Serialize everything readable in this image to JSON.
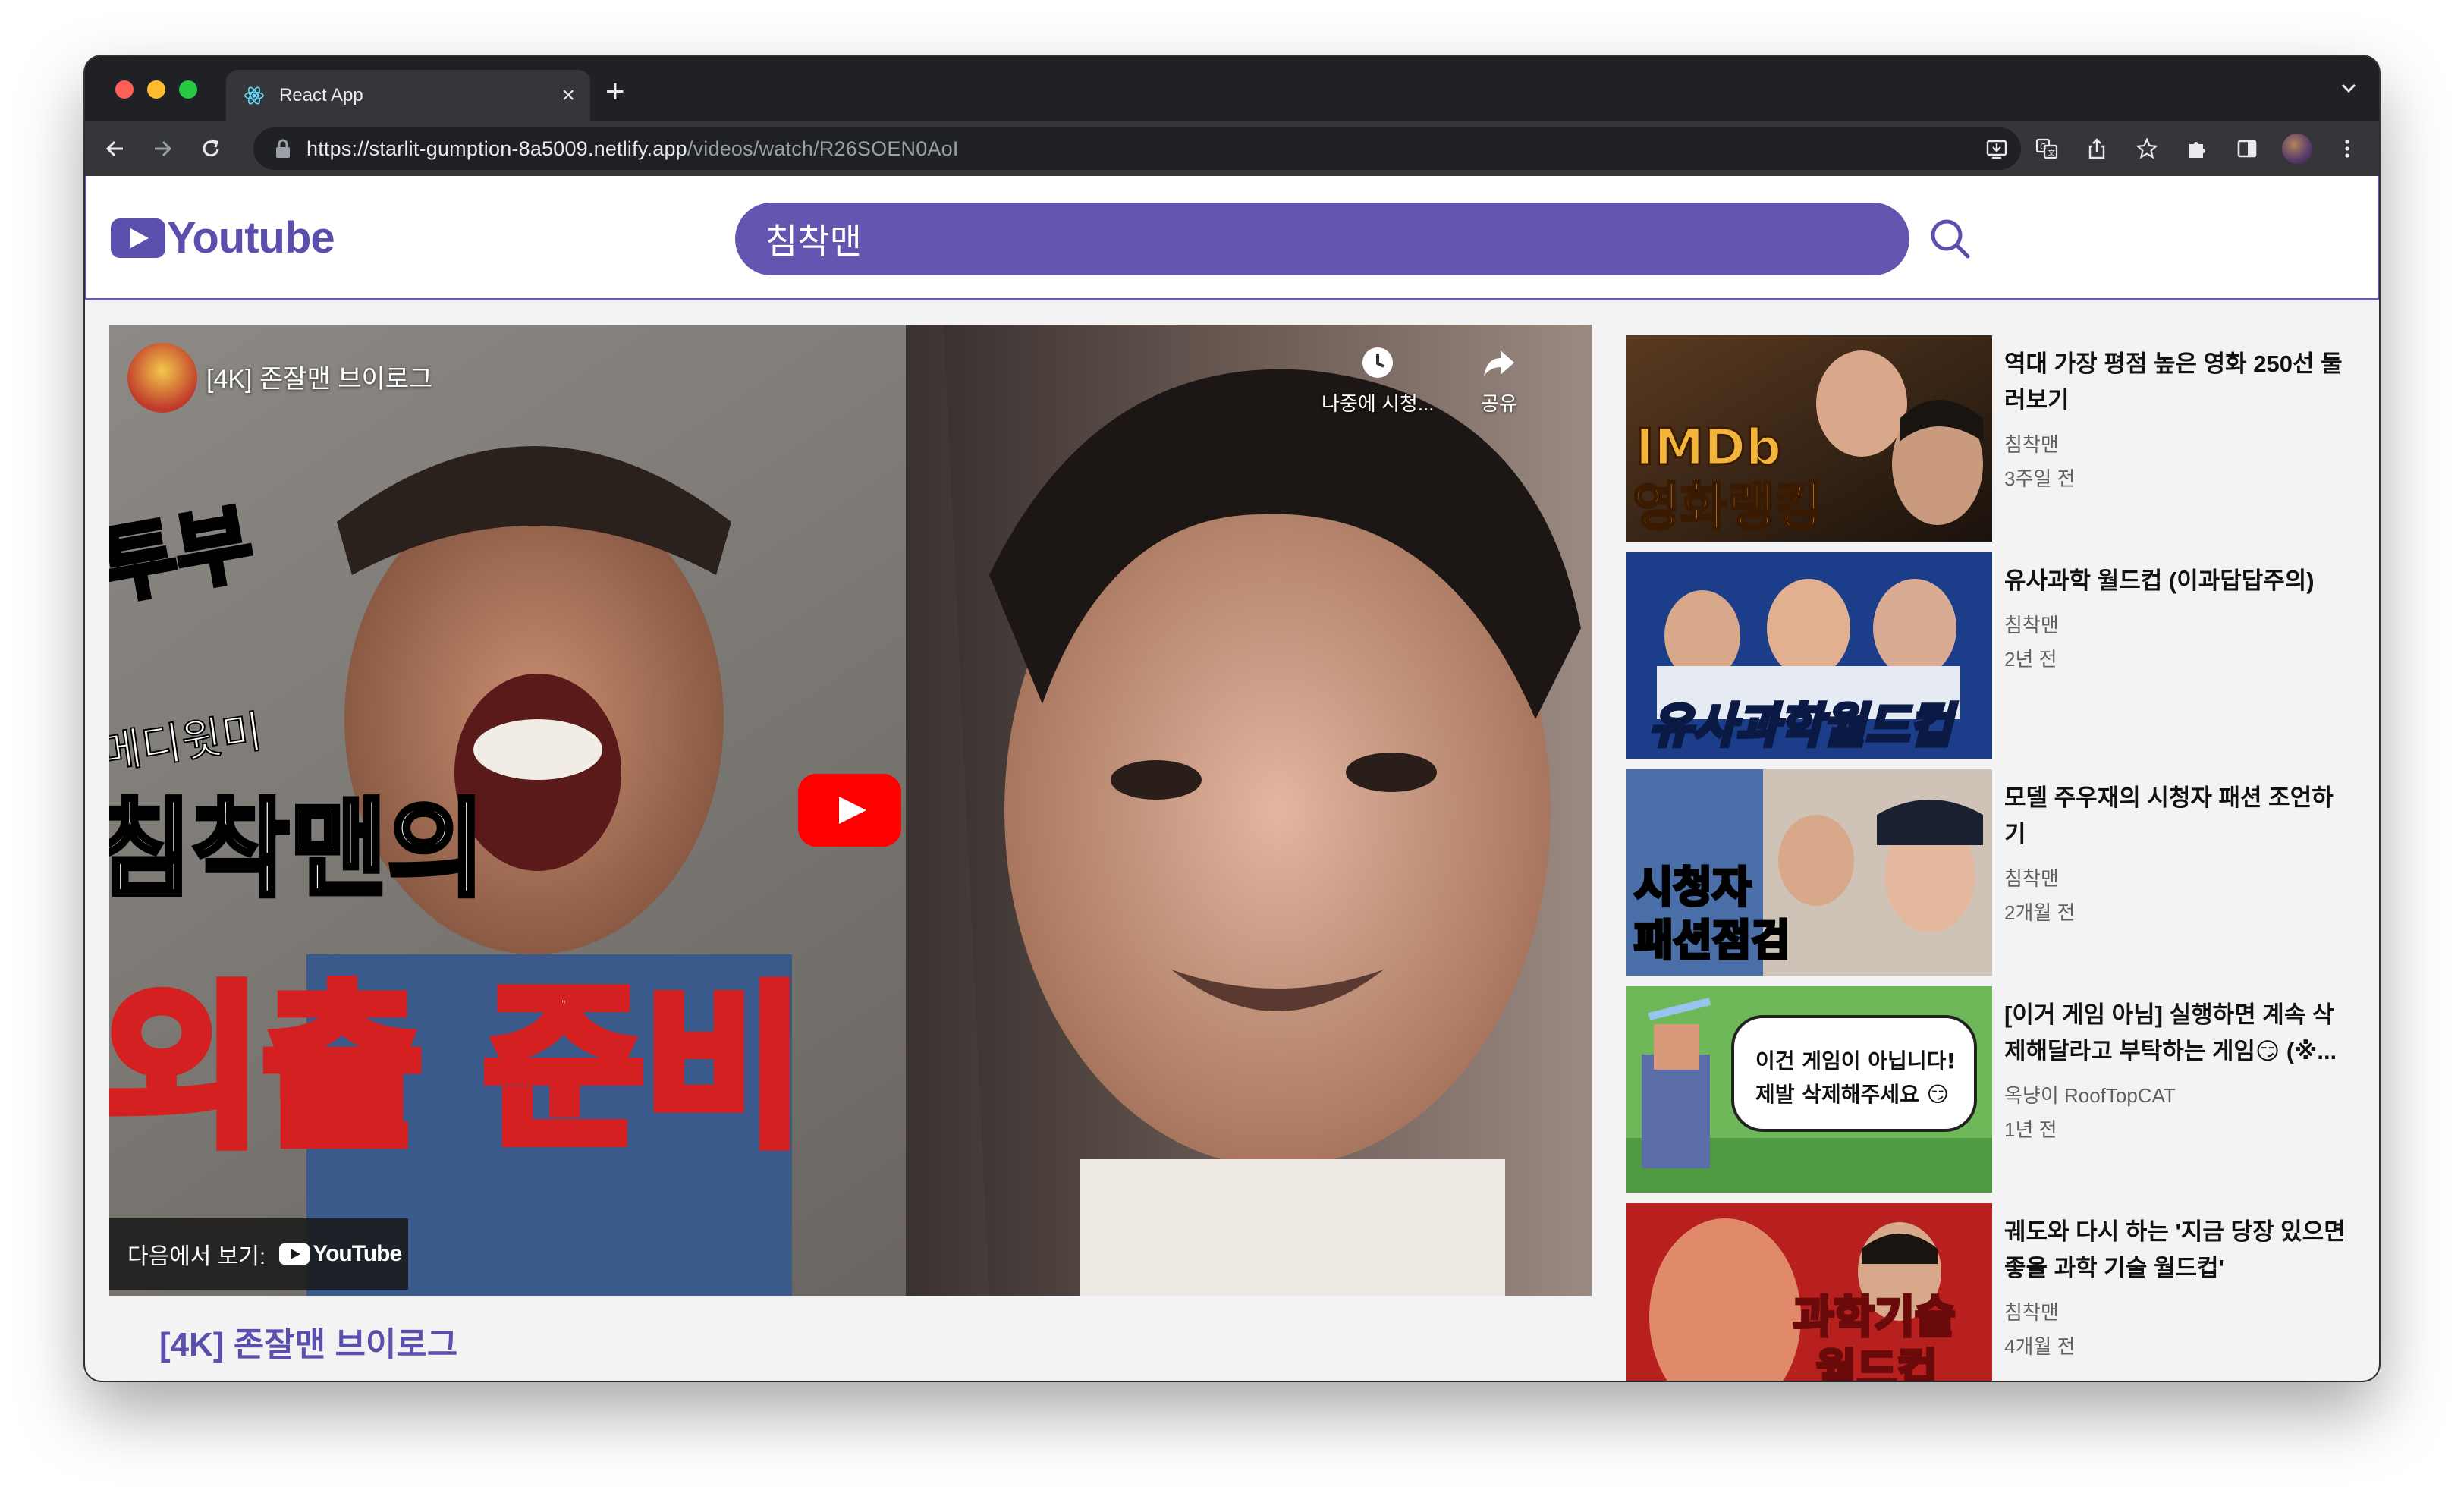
{
  "browser": {
    "tab_title": "React App",
    "url_host": "https://starlit-gumption-8a5009.netlify.app",
    "url_path": "/videos/watch/R26SOEN0AoI"
  },
  "app": {
    "logo_text": "Youtube",
    "search_value": "침착맨"
  },
  "player": {
    "video_title": "[4K] 존잘맨 브이로그",
    "watch_later_label": "나중에 시청...",
    "share_label": "공유",
    "watch_on_label": "다음에서 보기:",
    "youtube_wordmark": "YouTube",
    "thumbnail_text": {
      "top": "메디윗미",
      "line1": "침착맨의",
      "line2": "외출 준비",
      "badge": "투부"
    }
  },
  "main_title": "[4K] 존잘맨 브이로그",
  "related": [
    {
      "title": "역대 가장 평점 높은 영화 250선 둘러보기",
      "channel": "침착맨",
      "date": "3주일 전",
      "thumb_text": [
        "IMDb",
        "영화랭킹"
      ],
      "thumb_colors": [
        "#3a2a1a",
        "#d98a2a"
      ]
    },
    {
      "title": "유사과학 월드컵 (이과답답주의)",
      "channel": "침착맨",
      "date": "2년 전",
      "thumb_text": [
        "유사과학월드컵"
      ],
      "thumb_colors": [
        "#1c3d8a",
        "#dfe6f2"
      ]
    },
    {
      "title": "모델 주우재의 시청자 패션 조언하기",
      "channel": "침착맨",
      "date": "2개월 전",
      "thumb_text": [
        "시청자",
        "패션점검"
      ],
      "thumb_colors": [
        "#3e5a8c",
        "#e2b48a"
      ]
    },
    {
      "title": "[이거 게임 아님] 실행하면 계속 삭제해달라고 부탁하는 게임😏 (※...",
      "channel": "옥냥이 RoofTopCAT",
      "date": "1년 전",
      "thumb_text": [
        "이건 게임이 아닙니다!",
        "제발 삭제해주세요 😏"
      ],
      "thumb_colors": [
        "#6fb85a",
        "#dff0c8"
      ]
    },
    {
      "title": "궤도와 다시 하는 '지금 당장 있으면 좋을 과학 기술 월드컵'",
      "channel": "침착맨",
      "date": "4개월 전",
      "thumb_text": [
        "과학기술",
        "월드컵"
      ],
      "thumb_colors": [
        "#b81f1f",
        "#f0c07a"
      ]
    }
  ]
}
